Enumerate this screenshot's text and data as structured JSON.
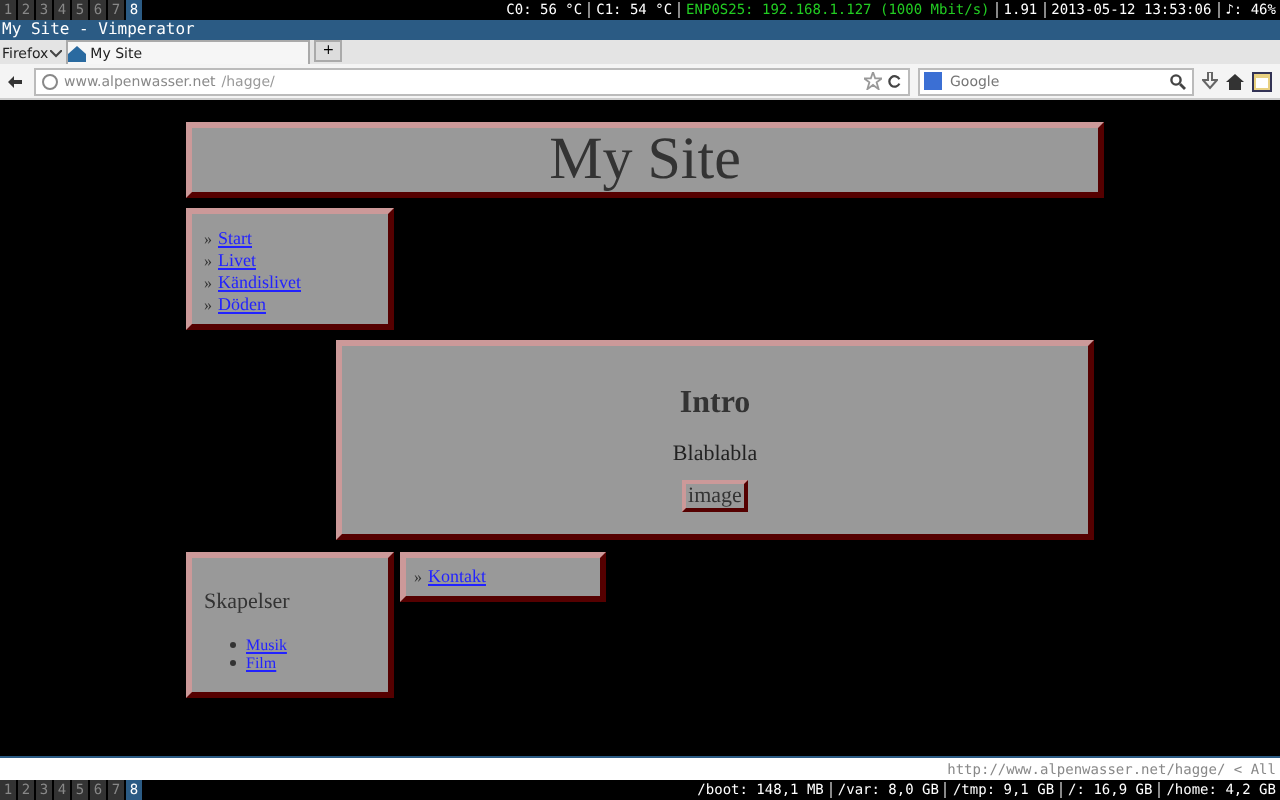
{
  "top_panel": {
    "workspaces": [
      {
        "label": "1",
        "selected": false
      },
      {
        "label": "2",
        "selected": false
      },
      {
        "label": "3",
        "selected": false
      },
      {
        "label": "4",
        "selected": false
      },
      {
        "label": "5",
        "selected": false
      },
      {
        "label": "6",
        "selected": false
      },
      {
        "label": "7",
        "selected": false
      },
      {
        "label": "8",
        "selected": true
      }
    ],
    "status": [
      {
        "text": "C0: 56 °C",
        "color": "#ffffff"
      },
      {
        "text": "C1: 54 °C",
        "color": "#ffffff"
      },
      {
        "text": "ENP0S25: 192.168.1.127 (1000 Mbit/s)",
        "color": "#22cc22"
      },
      {
        "text": "1.91",
        "color": "#ffffff"
      },
      {
        "text": "2013-05-12 13:53:06",
        "color": "#ffffff"
      },
      {
        "text": "♪: 46%",
        "color": "#ffffff"
      }
    ]
  },
  "window": {
    "title": "My Site - Vimperator"
  },
  "tabs": {
    "menu": "Firefox",
    "items": [
      {
        "label": "My Site",
        "selected": true
      }
    ],
    "new_tab": "+"
  },
  "nav": {
    "url_host": "www.alpenwasser.net",
    "url_path": "/hagge/",
    "search_placeholder": "Google"
  },
  "page": {
    "header": "My Site",
    "menu": [
      "Start",
      "Livet",
      "Kändislivet",
      "Döden"
    ],
    "menu_bullet": "»",
    "intro": {
      "title": "Intro",
      "text": "Blablabla",
      "image_alt": "image"
    },
    "side": {
      "title": "Skapelser",
      "links": [
        "Musik",
        "Film"
      ]
    },
    "footer_links": [
      "Kontakt"
    ]
  },
  "status_line": "http://www.alpenwasser.net/hagge/ < All",
  "bottom_panel": {
    "workspaces": [
      {
        "label": "1",
        "selected": false
      },
      {
        "label": "2",
        "selected": false
      },
      {
        "label": "3",
        "selected": false
      },
      {
        "label": "4",
        "selected": false
      },
      {
        "label": "5",
        "selected": false
      },
      {
        "label": "6",
        "selected": false
      },
      {
        "label": "7",
        "selected": false
      },
      {
        "label": "8",
        "selected": true
      }
    ],
    "disks": [
      "/boot: 148,1 MB",
      "/var: 8,0 GB",
      "/tmp: 9,1 GB",
      "/: 16,9 GB",
      "/home: 4,2 GB"
    ]
  }
}
